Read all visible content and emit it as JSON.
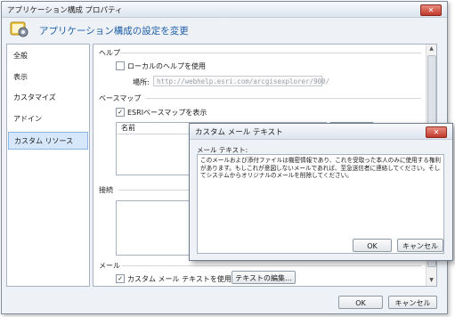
{
  "window": {
    "title": "アプリケーション構成 プロパティ",
    "close_label": "✕"
  },
  "header": {
    "title": "アプリケーション構成の設定を変更",
    "icon": "settings-gear-icon"
  },
  "sidebar": {
    "items": [
      {
        "label": "全般"
      },
      {
        "label": "表示"
      },
      {
        "label": "カスタマイズ"
      },
      {
        "label": "アドイン"
      },
      {
        "label": "カスタム リソース",
        "active": true
      }
    ]
  },
  "help": {
    "section_label": "ヘルプ",
    "local_help_label": "ローカルのヘルプを使用",
    "local_help_checked": false,
    "location_label": "場所:",
    "location_value": "http://webhelp.esri.com/arcgisexplorer/900/"
  },
  "basemap": {
    "section_label": "ベースマップ",
    "show_esri_label": "ESRIベースマップを表示",
    "show_esri_checked": true,
    "column_name": "名前"
  },
  "connection": {
    "section_label": "接続"
  },
  "mail": {
    "section_label": "メール",
    "custom_text_label": "カスタム メール テキストを使用",
    "custom_text_checked": true,
    "edit_button": "テキストの編集..."
  },
  "footer": {
    "ok": "OK",
    "cancel": "キャンセル"
  },
  "dialog": {
    "title": "カスタム メール テキスト",
    "close_label": "✕",
    "field_label": "メール テキスト:",
    "text": "このメールおよび添付ファイルは機密情報であり、これを受取った本人のみに使用する権利があります。もしこれが意図しないメールであれば、至急送信者に連絡してください。そしてシステムからオリジナルのメールを削除してください。",
    "ok": "OK",
    "cancel": "キャンセル"
  },
  "colors": {
    "accent": "#1f5fa8",
    "selected_bg": "#d6e7fb",
    "close_red": "#c0392b"
  }
}
